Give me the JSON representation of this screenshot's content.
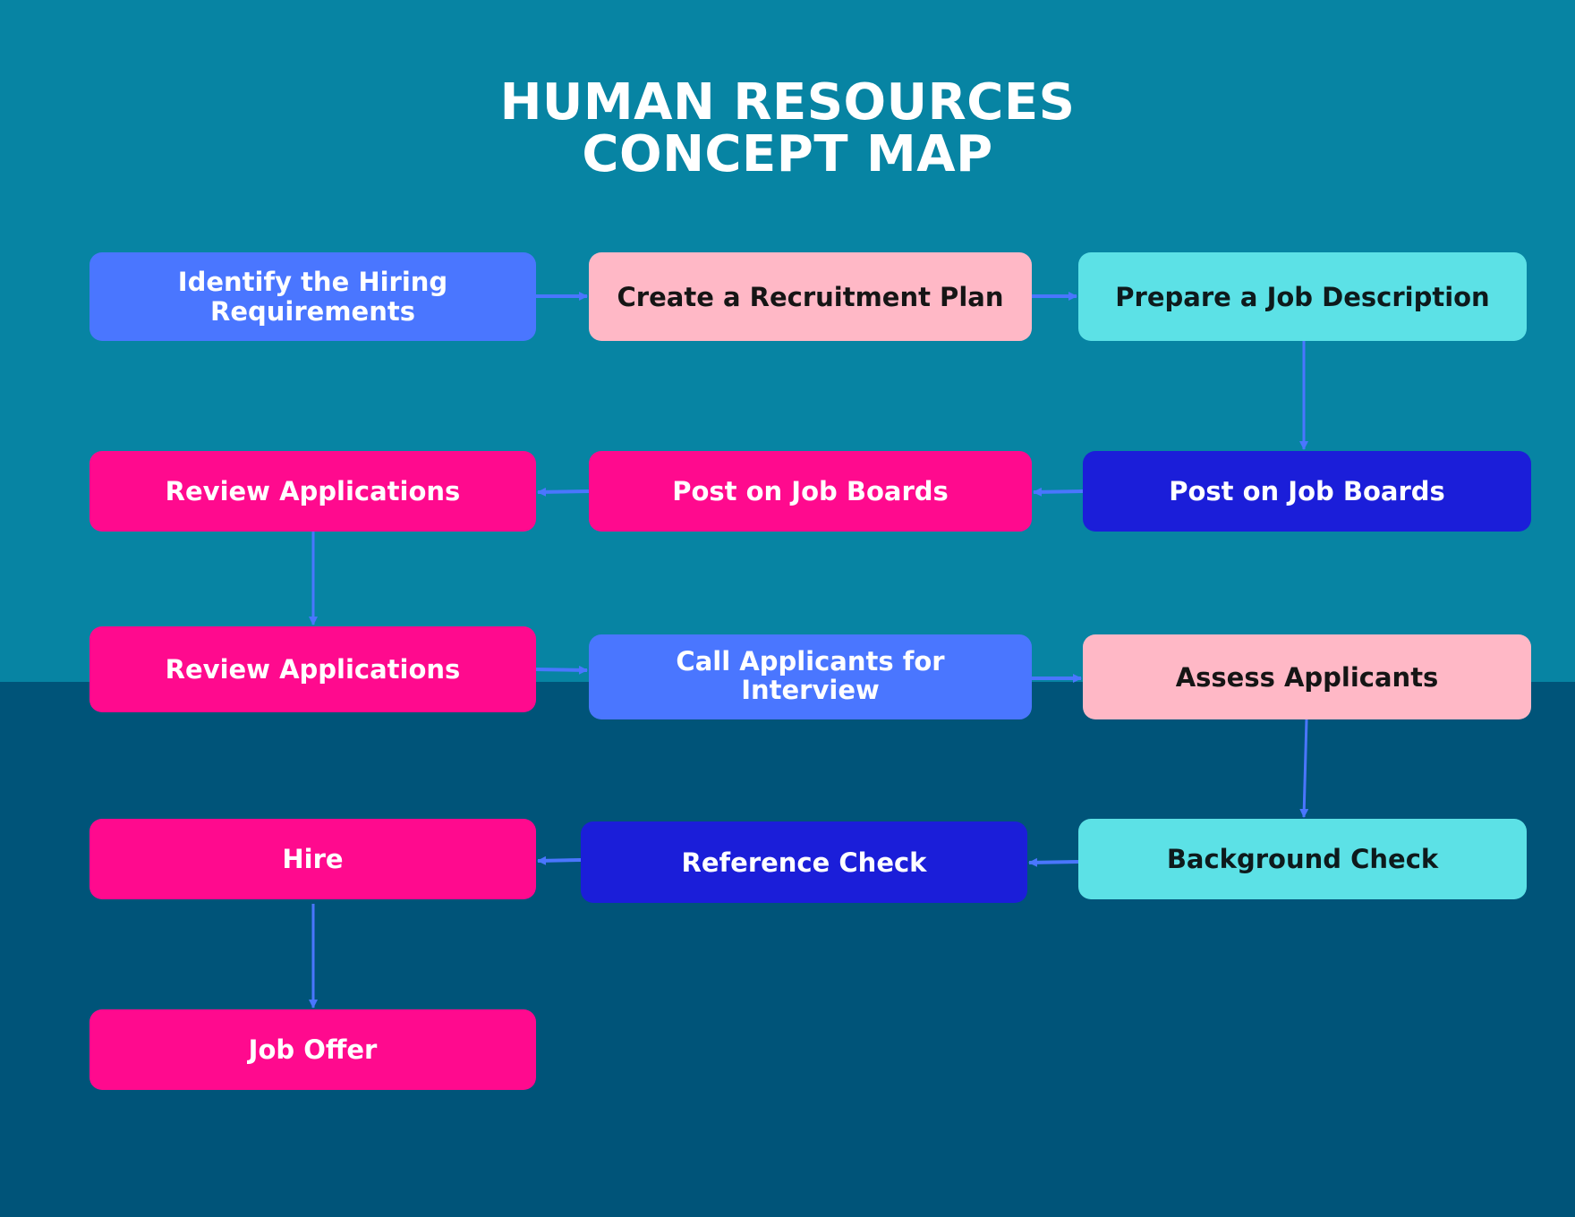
{
  "title": {
    "line1": "HUMAN RESOURCES",
    "line2": "CONCEPT MAP"
  },
  "colors": {
    "background_top": "#0784A3",
    "background_bottom": "#005479",
    "arrow": "#4A76FF",
    "blue": "#4A76FF",
    "pink": "#FFB8C6",
    "cyan": "#5CE1E6",
    "magenta": "#FF0A8E",
    "navy": "#1B1ED9"
  },
  "nodes": [
    {
      "id": "identify",
      "label": "Identify the Hiring Requirements",
      "color": "blue"
    },
    {
      "id": "recruitment-plan",
      "label": "Create a Recruitment Plan",
      "color": "pink"
    },
    {
      "id": "job-description",
      "label": "Prepare a Job Description",
      "color": "cyan"
    },
    {
      "id": "post-boards-navy",
      "label": "Post on Job Boards",
      "color": "navy"
    },
    {
      "id": "post-boards-pink",
      "label": "Post on Job Boards",
      "color": "magenta"
    },
    {
      "id": "review-1",
      "label": "Review Applications",
      "color": "magenta"
    },
    {
      "id": "review-2",
      "label": "Review Applications",
      "color": "magenta"
    },
    {
      "id": "call-applicants",
      "label": "Call Applicants for Interview",
      "color": "blue"
    },
    {
      "id": "assess",
      "label": "Assess Applicants",
      "color": "pink"
    },
    {
      "id": "background",
      "label": "Background Check",
      "color": "cyan"
    },
    {
      "id": "reference",
      "label": "Reference Check",
      "color": "navy"
    },
    {
      "id": "hire",
      "label": "Hire",
      "color": "magenta"
    },
    {
      "id": "job-offer",
      "label": "Job Offer",
      "color": "magenta"
    }
  ],
  "edges": [
    {
      "from": "identify",
      "to": "recruitment-plan"
    },
    {
      "from": "recruitment-plan",
      "to": "job-description"
    },
    {
      "from": "job-description",
      "to": "post-boards-navy"
    },
    {
      "from": "post-boards-navy",
      "to": "post-boards-pink"
    },
    {
      "from": "post-boards-pink",
      "to": "review-1"
    },
    {
      "from": "review-1",
      "to": "review-2"
    },
    {
      "from": "review-2",
      "to": "call-applicants"
    },
    {
      "from": "call-applicants",
      "to": "assess"
    },
    {
      "from": "assess",
      "to": "background"
    },
    {
      "from": "background",
      "to": "reference"
    },
    {
      "from": "reference",
      "to": "hire"
    },
    {
      "from": "hire",
      "to": "job-offer"
    }
  ]
}
